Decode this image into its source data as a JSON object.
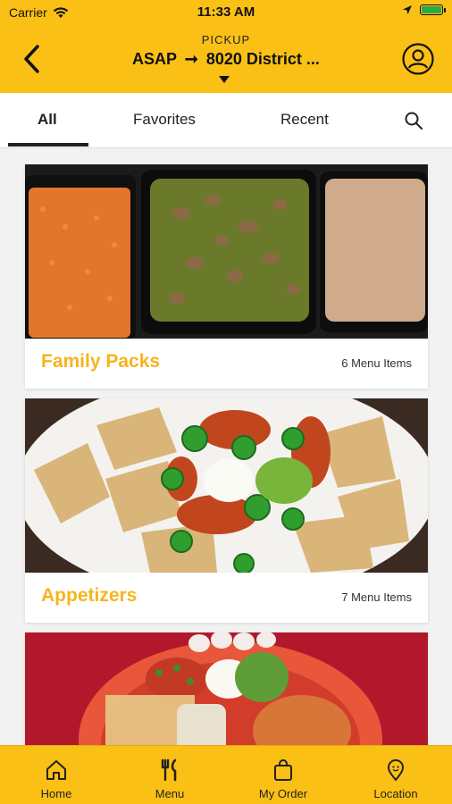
{
  "status": {
    "carrier": "Carrier",
    "time": "11:33 AM"
  },
  "header": {
    "mode": "PICKUP",
    "when": "ASAP",
    "location": "8020 District ..."
  },
  "tabs": {
    "all": "All",
    "favorites": "Favorites",
    "recent": "Recent"
  },
  "categories": [
    {
      "title": "Family Packs",
      "count": "6 Menu Items"
    },
    {
      "title": "Appetizers",
      "count": "7 Menu Items"
    },
    {
      "title": "",
      "count": ""
    }
  ],
  "bottom_nav": [
    {
      "label": "Home",
      "icon": "home-icon"
    },
    {
      "label": "Menu",
      "icon": "fork-knife-icon"
    },
    {
      "label": "My Order",
      "icon": "bag-icon"
    },
    {
      "label": "Location",
      "icon": "location-pin-icon"
    }
  ],
  "colors": {
    "accent": "#fbc015",
    "title_text": "#f5b51c"
  }
}
